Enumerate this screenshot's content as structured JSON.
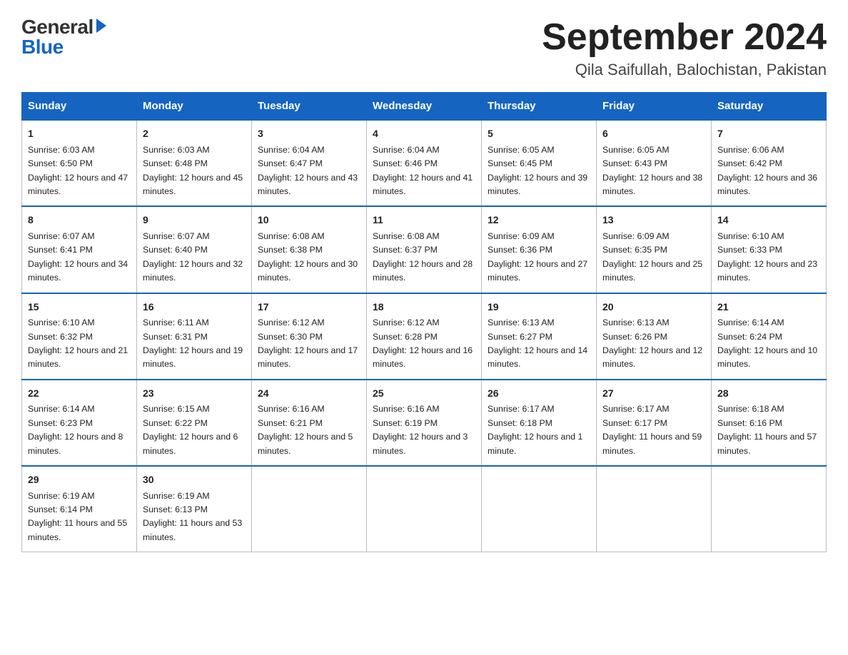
{
  "logo": {
    "text_general": "General",
    "text_blue": "Blue",
    "triangle_color": "#1565c0"
  },
  "header": {
    "month_year": "September 2024",
    "location": "Qila Saifullah, Balochistan, Pakistan"
  },
  "weekdays": [
    "Sunday",
    "Monday",
    "Tuesday",
    "Wednesday",
    "Thursday",
    "Friday",
    "Saturday"
  ],
  "weeks": [
    [
      {
        "day": "1",
        "sunrise": "6:03 AM",
        "sunset": "6:50 PM",
        "daylight": "12 hours and 47 minutes."
      },
      {
        "day": "2",
        "sunrise": "6:03 AM",
        "sunset": "6:48 PM",
        "daylight": "12 hours and 45 minutes."
      },
      {
        "day": "3",
        "sunrise": "6:04 AM",
        "sunset": "6:47 PM",
        "daylight": "12 hours and 43 minutes."
      },
      {
        "day": "4",
        "sunrise": "6:04 AM",
        "sunset": "6:46 PM",
        "daylight": "12 hours and 41 minutes."
      },
      {
        "day": "5",
        "sunrise": "6:05 AM",
        "sunset": "6:45 PM",
        "daylight": "12 hours and 39 minutes."
      },
      {
        "day": "6",
        "sunrise": "6:05 AM",
        "sunset": "6:43 PM",
        "daylight": "12 hours and 38 minutes."
      },
      {
        "day": "7",
        "sunrise": "6:06 AM",
        "sunset": "6:42 PM",
        "daylight": "12 hours and 36 minutes."
      }
    ],
    [
      {
        "day": "8",
        "sunrise": "6:07 AM",
        "sunset": "6:41 PM",
        "daylight": "12 hours and 34 minutes."
      },
      {
        "day": "9",
        "sunrise": "6:07 AM",
        "sunset": "6:40 PM",
        "daylight": "12 hours and 32 minutes."
      },
      {
        "day": "10",
        "sunrise": "6:08 AM",
        "sunset": "6:38 PM",
        "daylight": "12 hours and 30 minutes."
      },
      {
        "day": "11",
        "sunrise": "6:08 AM",
        "sunset": "6:37 PM",
        "daylight": "12 hours and 28 minutes."
      },
      {
        "day": "12",
        "sunrise": "6:09 AM",
        "sunset": "6:36 PM",
        "daylight": "12 hours and 27 minutes."
      },
      {
        "day": "13",
        "sunrise": "6:09 AM",
        "sunset": "6:35 PM",
        "daylight": "12 hours and 25 minutes."
      },
      {
        "day": "14",
        "sunrise": "6:10 AM",
        "sunset": "6:33 PM",
        "daylight": "12 hours and 23 minutes."
      }
    ],
    [
      {
        "day": "15",
        "sunrise": "6:10 AM",
        "sunset": "6:32 PM",
        "daylight": "12 hours and 21 minutes."
      },
      {
        "day": "16",
        "sunrise": "6:11 AM",
        "sunset": "6:31 PM",
        "daylight": "12 hours and 19 minutes."
      },
      {
        "day": "17",
        "sunrise": "6:12 AM",
        "sunset": "6:30 PM",
        "daylight": "12 hours and 17 minutes."
      },
      {
        "day": "18",
        "sunrise": "6:12 AM",
        "sunset": "6:28 PM",
        "daylight": "12 hours and 16 minutes."
      },
      {
        "day": "19",
        "sunrise": "6:13 AM",
        "sunset": "6:27 PM",
        "daylight": "12 hours and 14 minutes."
      },
      {
        "day": "20",
        "sunrise": "6:13 AM",
        "sunset": "6:26 PM",
        "daylight": "12 hours and 12 minutes."
      },
      {
        "day": "21",
        "sunrise": "6:14 AM",
        "sunset": "6:24 PM",
        "daylight": "12 hours and 10 minutes."
      }
    ],
    [
      {
        "day": "22",
        "sunrise": "6:14 AM",
        "sunset": "6:23 PM",
        "daylight": "12 hours and 8 minutes."
      },
      {
        "day": "23",
        "sunrise": "6:15 AM",
        "sunset": "6:22 PM",
        "daylight": "12 hours and 6 minutes."
      },
      {
        "day": "24",
        "sunrise": "6:16 AM",
        "sunset": "6:21 PM",
        "daylight": "12 hours and 5 minutes."
      },
      {
        "day": "25",
        "sunrise": "6:16 AM",
        "sunset": "6:19 PM",
        "daylight": "12 hours and 3 minutes."
      },
      {
        "day": "26",
        "sunrise": "6:17 AM",
        "sunset": "6:18 PM",
        "daylight": "12 hours and 1 minute."
      },
      {
        "day": "27",
        "sunrise": "6:17 AM",
        "sunset": "6:17 PM",
        "daylight": "11 hours and 59 minutes."
      },
      {
        "day": "28",
        "sunrise": "6:18 AM",
        "sunset": "6:16 PM",
        "daylight": "11 hours and 57 minutes."
      }
    ],
    [
      {
        "day": "29",
        "sunrise": "6:19 AM",
        "sunset": "6:14 PM",
        "daylight": "11 hours and 55 minutes."
      },
      {
        "day": "30",
        "sunrise": "6:19 AM",
        "sunset": "6:13 PM",
        "daylight": "11 hours and 53 minutes."
      },
      null,
      null,
      null,
      null,
      null
    ]
  ]
}
